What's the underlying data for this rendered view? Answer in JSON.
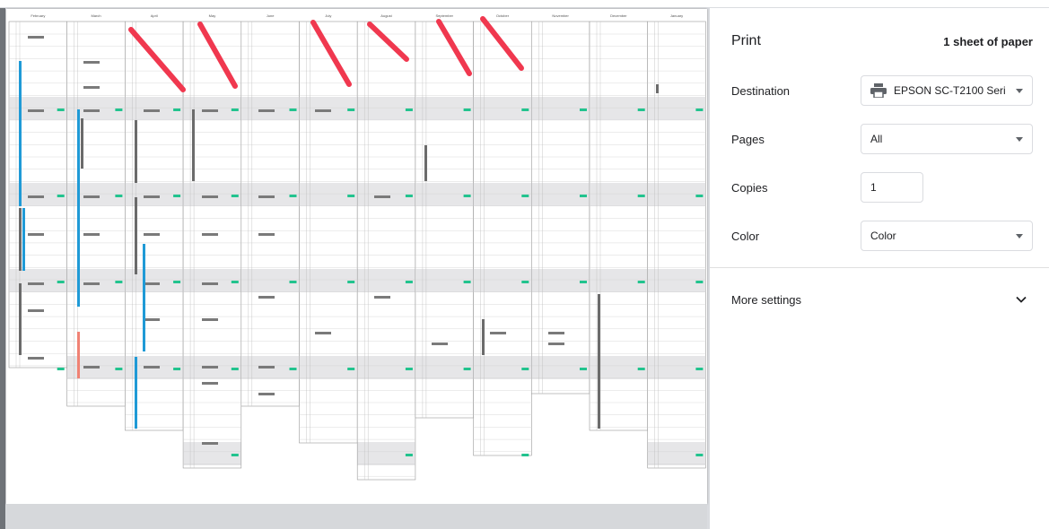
{
  "print_panel": {
    "title": "Print",
    "sheet_count": "1 sheet of paper",
    "destination": {
      "label": "Destination",
      "value": "EPSON SC-T2100 Seri"
    },
    "pages": {
      "label": "Pages",
      "value": "All"
    },
    "copies": {
      "label": "Copies",
      "value": "1"
    },
    "color": {
      "label": "Color",
      "value": "Color"
    },
    "more_settings": "More settings"
  },
  "calendar_preview": {
    "months": [
      "February",
      "March",
      "April",
      "May",
      "June",
      "July",
      "August",
      "September",
      "October",
      "November",
      "December",
      "January"
    ],
    "annotation_color": "#f0384f",
    "event_colors": {
      "grey": "#6b6b6b",
      "blue": "#1f9ad6",
      "green": "#22c38e",
      "salmon": "#f08274"
    }
  },
  "icons": {
    "printer": "printer-icon",
    "caret": "caret-down-icon",
    "expand": "chevron-down-icon"
  }
}
